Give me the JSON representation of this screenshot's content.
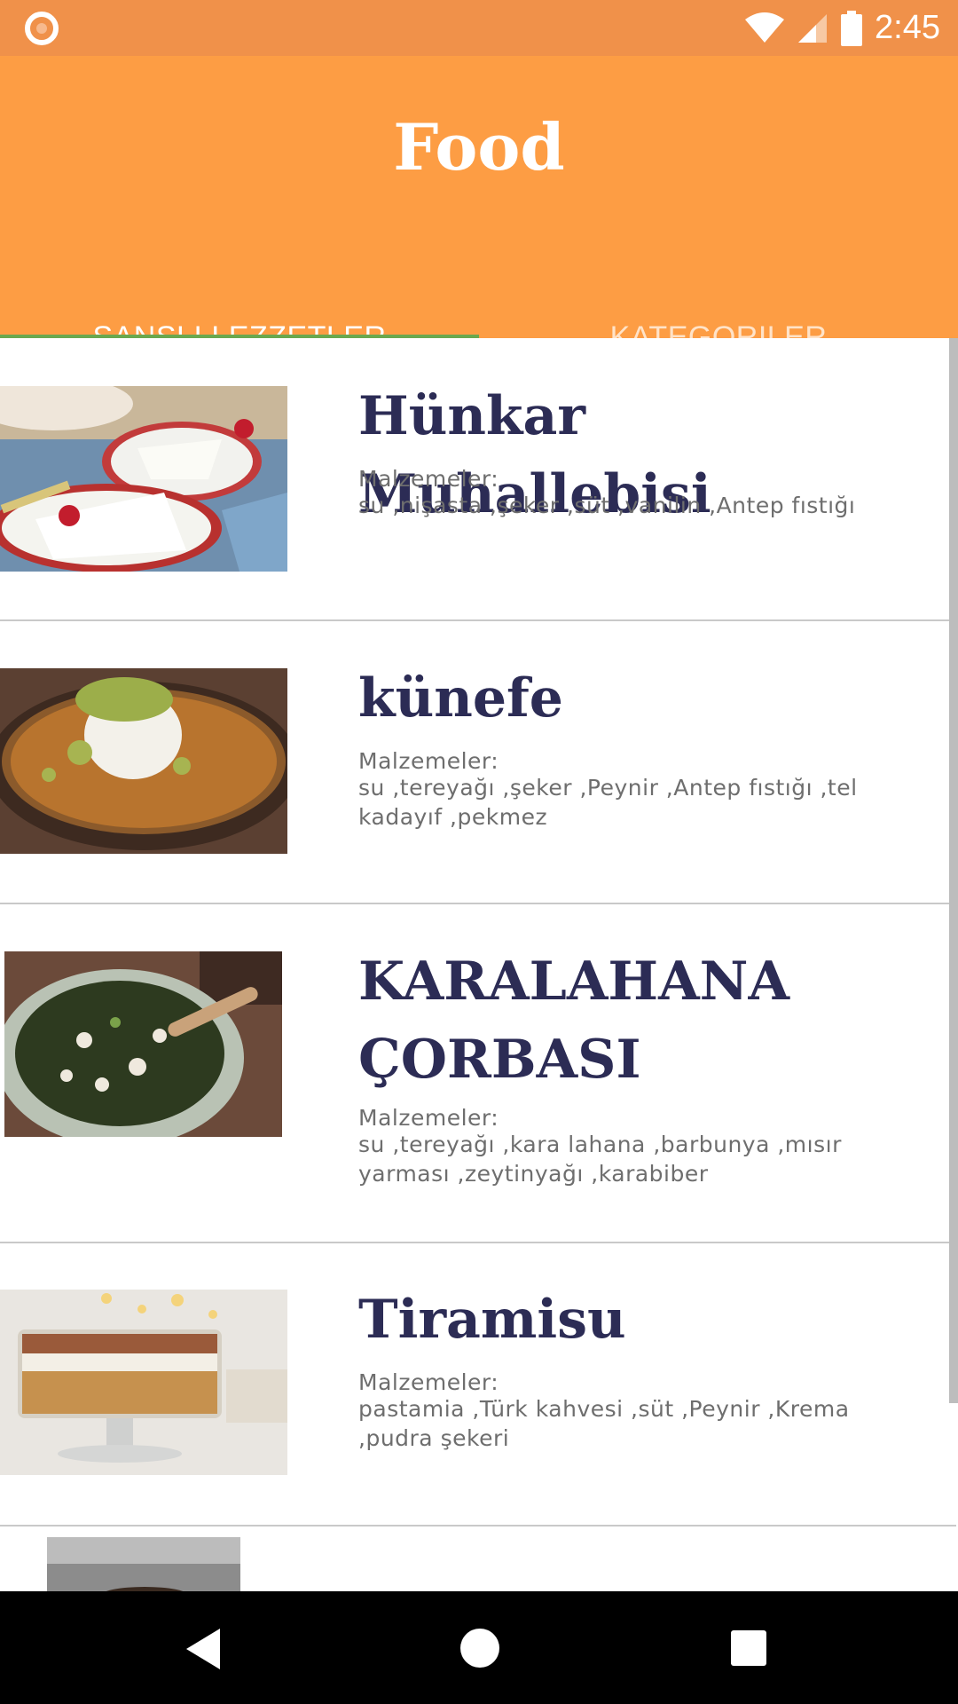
{
  "status_bar": {
    "time": "2:45"
  },
  "app_bar": {
    "title": "Food"
  },
  "tabs": [
    {
      "label": "ŞANSLI LEZZETLER"
    },
    {
      "label": "KATEGORILER"
    }
  ],
  "recipes": [
    {
      "title": "Hünkar Muhallebisi",
      "ingredients_label": "Malzemeler:",
      "ingredients": "su ,nişasta ,şeker ,süt ,vanilin ,Antep fıstığı"
    },
    {
      "title": "künefe",
      "ingredients_label": "Malzemeler:",
      "ingredients": "su ,tereyağı ,şeker ,Peynir ,Antep fıstığı ,tel kadayıf ,pekmez"
    },
    {
      "title": "KARALAHANA ÇORBASI",
      "ingredients_label": "Malzemeler:",
      "ingredients": "su ,tereyağı ,kara lahana ,barbunya ,mısır yarması ,zeytinyağı ,karabiber"
    },
    {
      "title": "Tiramisu",
      "ingredients_label": "Malzemeler:",
      "ingredients": "pastamia ,Türk kahvesi ,süt ,Peynir ,Krema ,pudra şekeri"
    }
  ],
  "icons": {
    "status_left": "notification-circle-icon",
    "wifi": "wifi-icon",
    "signal": "cell-signal-icon",
    "battery": "battery-icon",
    "nav_back": "back-icon",
    "nav_home": "home-icon",
    "nav_recents": "recents-icon"
  },
  "colors": {
    "status_bar": "#f0914a",
    "app_bar": "#fd9d44",
    "tab_indicator": "#6aa84f",
    "title_text": "#2c2c55"
  }
}
